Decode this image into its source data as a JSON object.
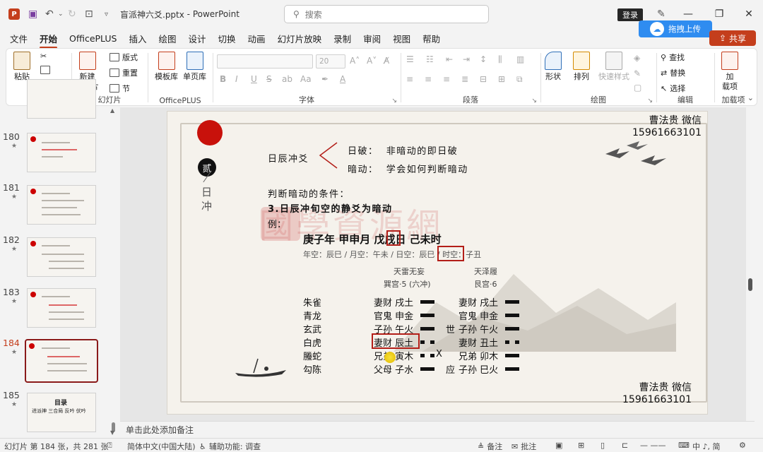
{
  "titlebar": {
    "app_icon": "P",
    "filename": "盲派神六爻.pptx",
    "app_name": "PowerPoint",
    "search_placeholder": "搜索",
    "login": "登录"
  },
  "tabs": [
    "文件",
    "开始",
    "OfficePLUS",
    "插入",
    "绘图",
    "设计",
    "切换",
    "动画",
    "幻灯片放映",
    "录制",
    "审阅",
    "视图",
    "帮助"
  ],
  "active_tab": "开始",
  "upload_btn": "拖拽上传",
  "share_btn": "共享",
  "ribbon": {
    "groups": {
      "clipboard": "剪贴板",
      "slides": "幻灯片",
      "officeplus": "OfficePLUS",
      "font": "字体",
      "paragraph": "段落",
      "drawing": "绘图",
      "editing": "编辑",
      "addins": "加载项"
    },
    "paste": "粘贴",
    "new_slide": "新建\n幻灯片",
    "layout": "版式",
    "reset": "重置",
    "section": "节",
    "template_lib": "模板库",
    "single_page_lib": "单页库",
    "font_size": "20",
    "shape": "形状",
    "arrange": "排列",
    "quick_style": "快速样式",
    "find": "查找",
    "replace": "替换",
    "select": "选择",
    "addins_btn": "加\n载项"
  },
  "thumbnails": [
    {
      "num": "180",
      "star": "★"
    },
    {
      "num": "181",
      "star": "★"
    },
    {
      "num": "182",
      "star": "★"
    },
    {
      "num": "183",
      "star": "★"
    },
    {
      "num": "184",
      "star": "★"
    },
    {
      "num": "185",
      "star": "★"
    }
  ],
  "thumb185": {
    "title": "目录",
    "items": "进派神  三合局  反吟  伏吟"
  },
  "slide": {
    "vertical_char": "贰",
    "vertical_text": "日冲",
    "wechat_top": "曹法贵   微信",
    "phone_top": "15961663101",
    "wechat_bottom": "曹法贵   微信",
    "phone_bottom": "15961663101",
    "topic": "日辰冲爻",
    "branch1_label": "日破：",
    "branch1_text": "非暗动的即日破",
    "branch2_label": "暗动：",
    "branch2_text": "学会如何判断暗动",
    "condition_title": "判断暗动的条件：",
    "condition_1": "3.日辰冲旬空的静爻为暗动",
    "example": "例：",
    "date_line": "庚子年 甲申月 戊戌日 己未时",
    "void_line": "年空：辰巳 / 月空：午未 / 日空：辰巳 / 时空：子丑",
    "watermark": "國學資源網",
    "watermark_url": "www.guoxue.com",
    "hex_left_name": "天雷无妄",
    "hex_left_palace": "巽宫·5 (六冲)",
    "hex_right_name": "天泽履",
    "hex_right_palace": "艮宫·6",
    "spirits": [
      "朱雀",
      "青龙",
      "玄武",
      "白虎",
      "螣蛇",
      "勾陈"
    ],
    "left_lines": [
      "妻财 戌土",
      "官鬼 申金",
      "子孙 午火",
      "妻财 辰土",
      "兄弟 寅木",
      "父母 子水"
    ],
    "left_marks": [
      "",
      "",
      "世",
      "",
      "",
      "应"
    ],
    "moving_mark": "X",
    "right_lines": [
      "妻财 戌土",
      "官鬼 申金",
      "子孙 午火",
      "妻财 丑土",
      "兄弟 卯木",
      "子孙 巳火"
    ]
  },
  "notes_placeholder": "单击此处添加备注",
  "statusbar": {
    "slide_info": "幻灯片 第 184 张，共 281 张",
    "language": "简体中文(中国大陆)",
    "accessibility": "辅助功能: 调查",
    "notes": "备注",
    "comments": "批注",
    "ime": "中 ♪, 简"
  }
}
